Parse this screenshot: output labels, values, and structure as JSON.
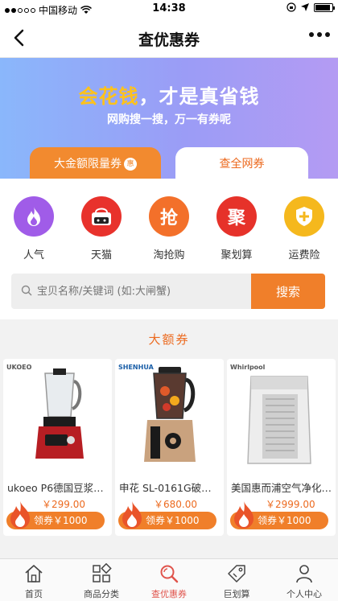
{
  "status_bar": {
    "carrier": "中国移动",
    "time": "14:38",
    "battery_level": 0.8
  },
  "nav": {
    "title": "查优惠券"
  },
  "banner": {
    "slogan_highlight": "会花钱",
    "slogan_rest": "，才是真省钱",
    "subtitle": "网购搜一搜，万一有券呢"
  },
  "tabs": [
    {
      "label": "大金额限量券",
      "badge": "惠",
      "active": false
    },
    {
      "label": "查全网券",
      "active": true
    }
  ],
  "categories": [
    {
      "label": "人气",
      "icon": "fire-icon",
      "color": "#a05ce8"
    },
    {
      "label": "天猫",
      "icon": "tmall-bag-icon",
      "color": "#e8322c"
    },
    {
      "label": "淘抢购",
      "icon": "qiang-icon",
      "glyph": "抢",
      "color": "#f3702a"
    },
    {
      "label": "聚划算",
      "icon": "ju-icon",
      "glyph": "聚",
      "color": "#e6322a"
    },
    {
      "label": "运费险",
      "icon": "shield-plus-icon",
      "color": "#f5b81d"
    }
  ],
  "search": {
    "placeholder": "宝贝名称/关键词 (如:大闸蟹)",
    "button": "搜索"
  },
  "section": {
    "title": "大额券"
  },
  "products": [
    {
      "brand": "UKOEO",
      "name": "ukoeo P6德国豆浆…",
      "price": "￥299.00",
      "coupon": "领券￥1000"
    },
    {
      "brand": "SHENHUA",
      "name": "申花 SL-0161G破壁…",
      "price": "￥680.00",
      "coupon": "领券￥1000"
    },
    {
      "brand": "Whirlpool",
      "name": "美国惠而浦空气净化…",
      "price": "￥2999.00",
      "coupon": "领券￥1000"
    }
  ],
  "tabbar": [
    {
      "label": "首页",
      "icon": "home-icon",
      "active": false
    },
    {
      "label": "商品分类",
      "icon": "category-grid-icon",
      "active": false
    },
    {
      "label": "查优惠券",
      "icon": "search-icon",
      "active": true
    },
    {
      "label": "巨划算",
      "icon": "tag-icon",
      "active": false
    },
    {
      "label": "个人中心",
      "icon": "person-icon",
      "active": false
    }
  ],
  "colors": {
    "accent": "#f07f2a",
    "active_tab": "#e0544c",
    "price": "#ec6a1f",
    "banner_highlight": "#ffc21a"
  }
}
